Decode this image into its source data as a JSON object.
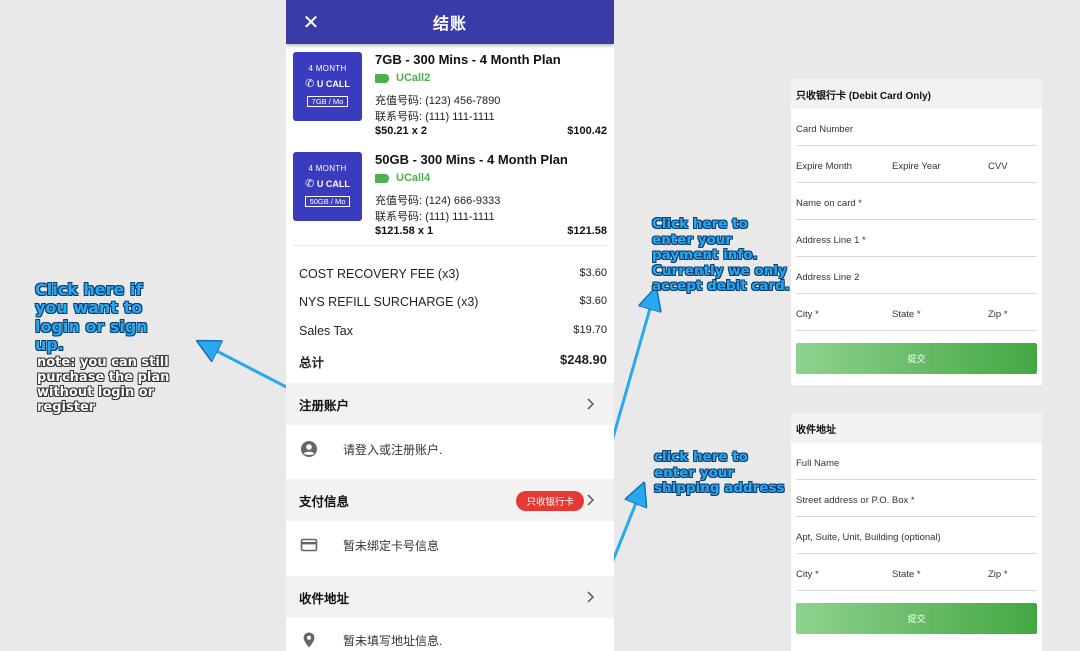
{
  "annotations": {
    "login": "Click here if you want to login or sign up.",
    "login_note": "note: you can still purchase the plan without login or register",
    "payment": "Click here to enter your payment info. Currently we only accept debit card.",
    "shipping": "click here to enter your shipping address"
  },
  "appbar": {
    "title": "结账",
    "close_icon": "close-icon"
  },
  "items": [
    {
      "thumb_line1": "4 MONTH",
      "thumb_brand": "U CALL",
      "thumb_tag": "7GB / Mo",
      "name": "7GB - 300 Mins - 4 Month Plan",
      "brand": "UCall2",
      "recharge": "充值号码: (123) 456-7890",
      "contact": "联系号码: (111) 111-1111",
      "unit_price": "$50.21 x 2",
      "line_total": "$100.42"
    },
    {
      "thumb_line1": "4 MONTH",
      "thumb_brand": "U CALL",
      "thumb_tag": "50GB / Mo",
      "name": "50GB - 300 Mins - 4 Month Plan",
      "brand": "UCall4",
      "recharge": "充值号码: (124) 666-9333",
      "contact": "联系号码: (111) 111-1111",
      "unit_price": "$121.58 x 1",
      "line_total": "$121.58"
    }
  ],
  "fees": [
    {
      "label": "COST RECOVERY FEE (x3)",
      "value": "$3.60"
    },
    {
      "label": "NYS REFILL SURCHARGE (x3)",
      "value": "$3.60"
    },
    {
      "label": "Sales Tax",
      "value": "$19.70"
    }
  ],
  "total": {
    "label": "总计",
    "value": "$248.90"
  },
  "account": {
    "title": "注册账户",
    "text": "请登入或注册账户."
  },
  "payment": {
    "title": "支付信息",
    "badge": "只收银行卡",
    "text": "暂未绑定卡号信息"
  },
  "shipping": {
    "title": "收件地址",
    "text": "暂未填写地址信息."
  },
  "card_form": {
    "title": "只收银行卡 (Debit Card Only)",
    "card_number": "Card Number",
    "expire_month": "Expire Month",
    "expire_year": "Expire Year",
    "cvv": "CVV",
    "name_on_card": "Name on card *",
    "address1": "Address Line 1 *",
    "address2": "Address Line 2",
    "city": "City *",
    "state": "State *",
    "zip": "Zip *",
    "submit": "提交"
  },
  "address_form": {
    "title": "收件地址",
    "full_name": "Full Name",
    "street": "Street address or P.O. Box *",
    "apt": "Apt, Suite, Unit, Building (optional)",
    "city": "City *",
    "state": "State *",
    "zip": "Zip *",
    "submit": "提交"
  },
  "colors": {
    "appbar": "#3a3aa8",
    "thumb": "#3b3bc0",
    "brand": "#4caf50",
    "badge": "#e53935",
    "arrow": "#29a8f0"
  }
}
